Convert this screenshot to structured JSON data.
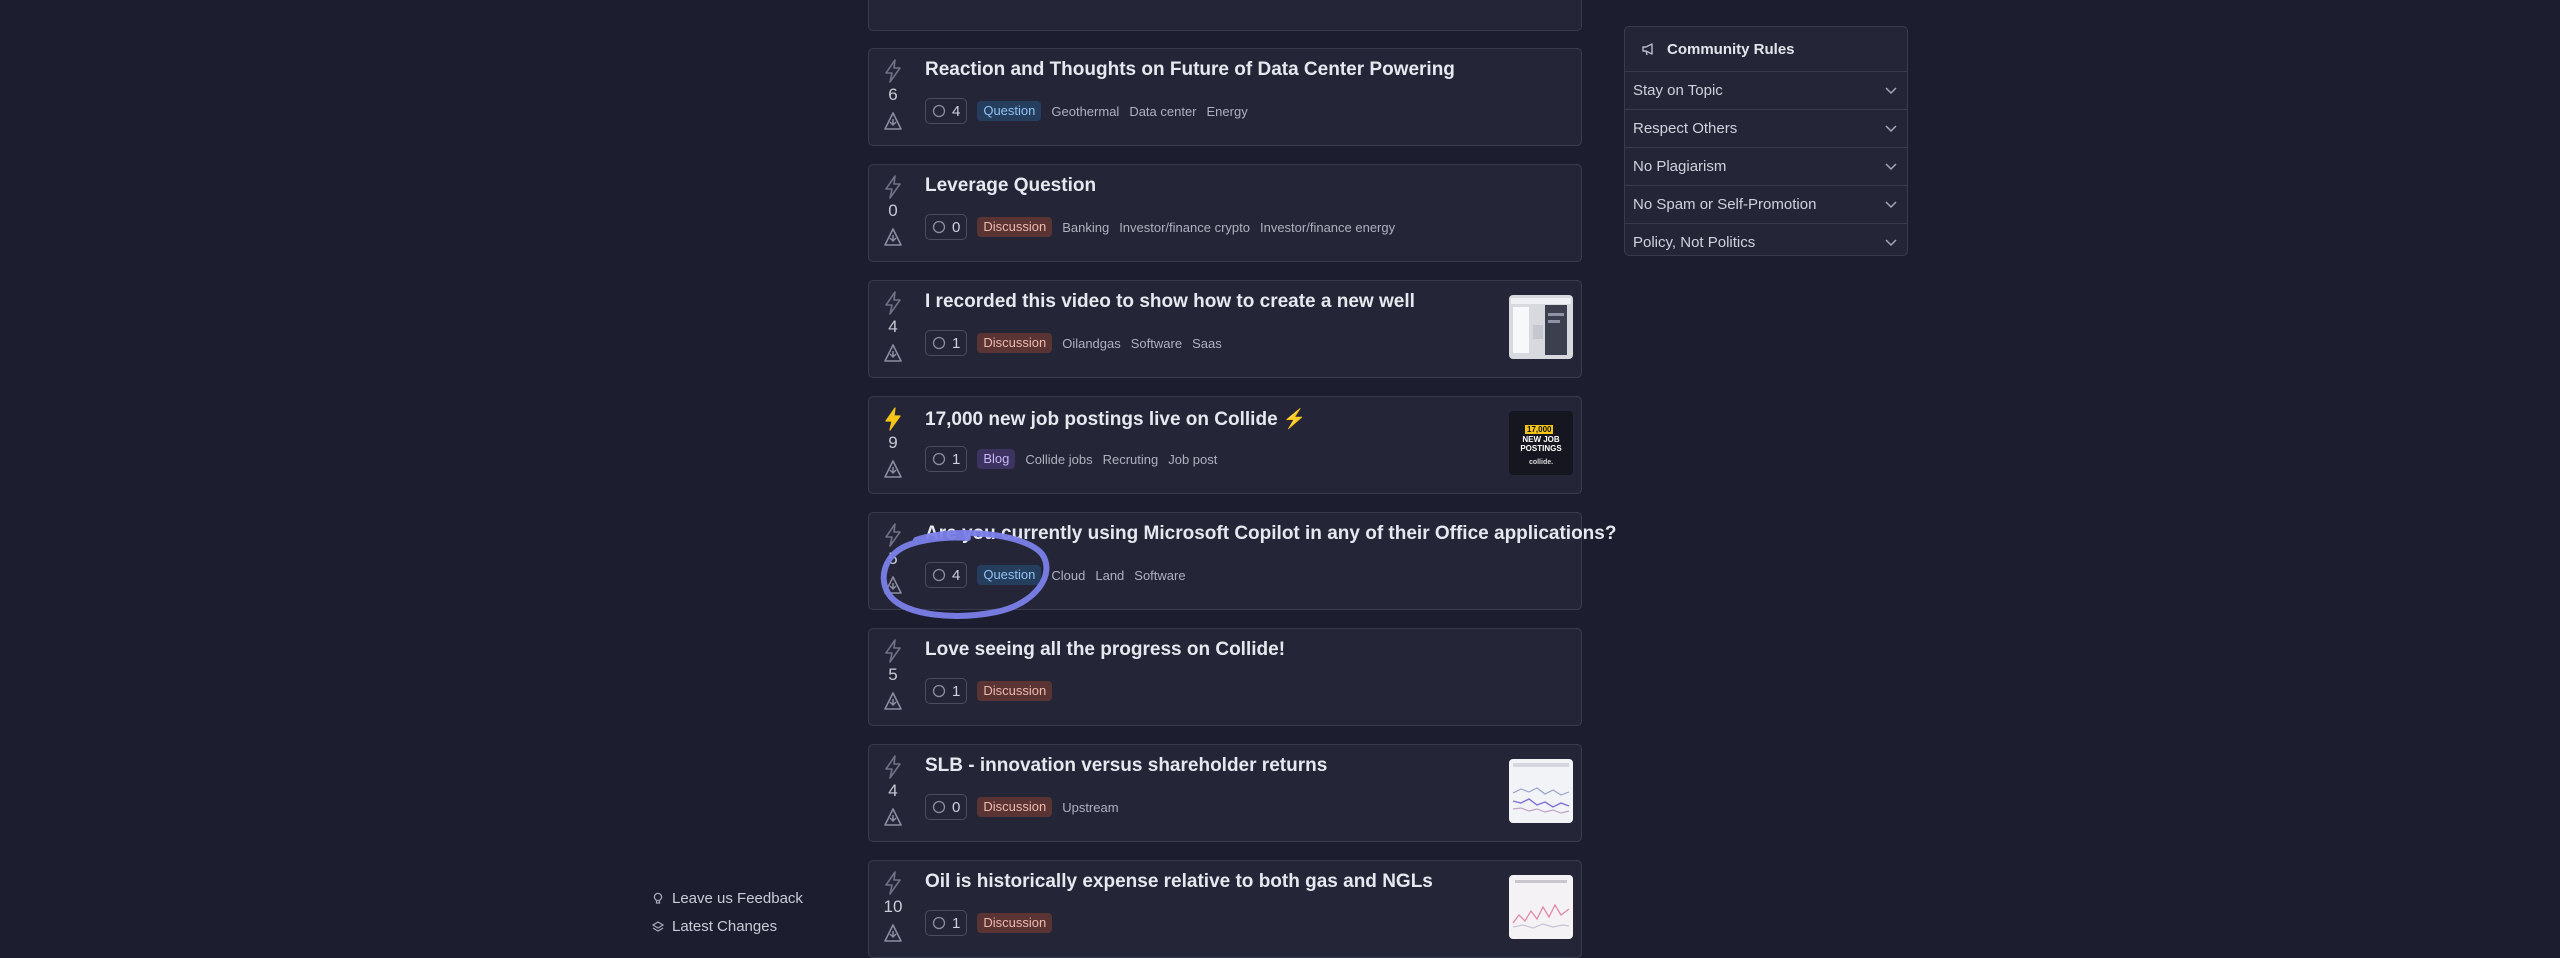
{
  "posts": [
    {
      "title": "Reaction and Thoughts on Future of Data Center Powering",
      "score": "6",
      "comments": "4",
      "badge": "Question",
      "tags": [
        "Geothermal",
        "Data center",
        "Energy"
      ]
    },
    {
      "title": "Leverage Question",
      "score": "0",
      "comments": "0",
      "badge": "Discussion",
      "tags": [
        "Banking",
        "Investor/finance crypto",
        "Investor/finance energy"
      ]
    },
    {
      "title": "I recorded this video to show how to create a new well",
      "score": "4",
      "comments": "1",
      "badge": "Discussion",
      "tags": [
        "Oilandgas",
        "Software",
        "Saas"
      ]
    },
    {
      "title": "17,000 new job postings live on Collide ⚡",
      "score": "9",
      "comments": "1",
      "badge": "Blog",
      "tags": [
        "Collide jobs",
        "Recruting",
        "Job post"
      ]
    },
    {
      "title": "Are you currently using Microsoft Copilot in any of their Office applications?",
      "score": "5",
      "comments": "4",
      "badge": "Question",
      "tags": [
        "Cloud",
        "Land",
        "Software"
      ]
    },
    {
      "title": "Love seeing all the progress on Collide!",
      "score": "5",
      "comments": "1",
      "badge": "Discussion",
      "tags": []
    },
    {
      "title": "SLB - innovation versus shareholder returns",
      "score": "4",
      "comments": "0",
      "badge": "Discussion",
      "tags": [
        "Upstream"
      ]
    },
    {
      "title": "Oil is historically expense relative to both gas and NGLs",
      "score": "10",
      "comments": "1",
      "badge": "Discussion",
      "tags": []
    }
  ],
  "thumbs": {
    "jobs": {
      "line1": "17,000",
      "line2": "NEW JOB",
      "line3": "POSTINGS",
      "brand": "collide."
    }
  },
  "community_rules": {
    "title": "Community Rules",
    "items": [
      "Stay on Topic",
      "Respect Others",
      "No Plagiarism",
      "No Spam or Self-Promotion",
      "Policy, Not Politics"
    ]
  },
  "footer": {
    "feedback": "Leave us Feedback",
    "changes": "Latest Changes"
  },
  "colors": {
    "background": "#1c1d2e",
    "card": "#242637",
    "annotation": "#7b7fe8",
    "active_bolt": "#f5c518"
  }
}
